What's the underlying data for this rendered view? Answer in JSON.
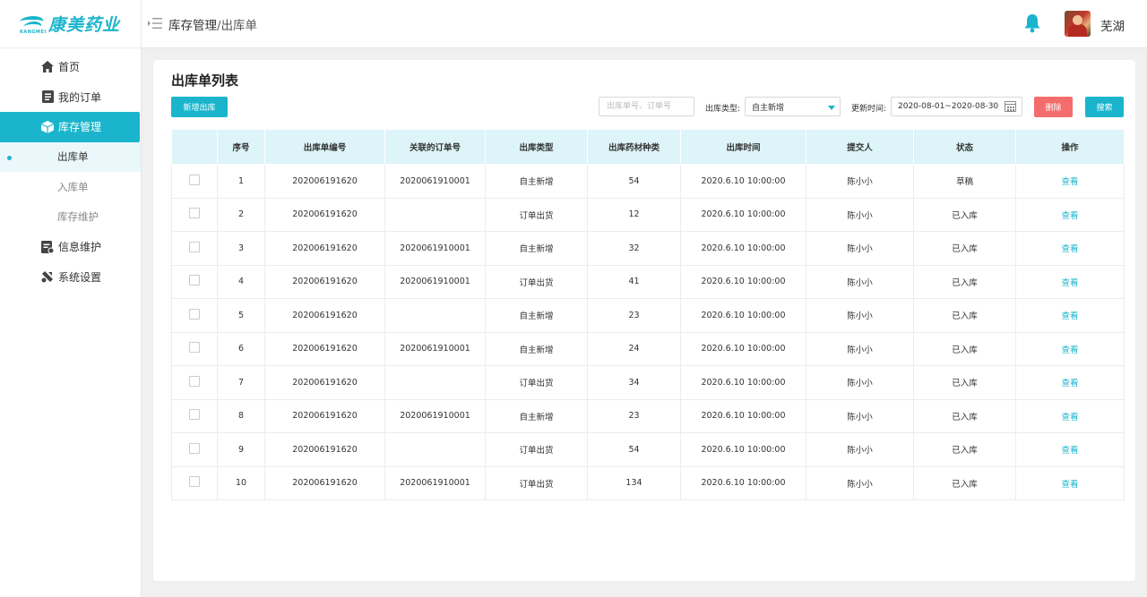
{
  "brand": {
    "name": "康美药业",
    "subtitle": "KANGMEI",
    "color": "#1ab5cc"
  },
  "sidebar": {
    "items": [
      {
        "label": "首页",
        "icon": "home-icon"
      },
      {
        "label": "我的订单",
        "icon": "order-icon"
      },
      {
        "label": "库存管理",
        "icon": "box-icon",
        "active": true
      },
      {
        "label": "出库单",
        "sub": true,
        "current": true
      },
      {
        "label": "入库单",
        "sub": true
      },
      {
        "label": "库存维护",
        "sub": true
      },
      {
        "label": "信息维护",
        "icon": "info-icon"
      },
      {
        "label": "系统设置",
        "icon": "settings-icon"
      }
    ]
  },
  "header": {
    "breadcrumb_parent": "库存管理",
    "breadcrumb_sep": "/",
    "breadcrumb_current": "出库单",
    "username": "芜湖"
  },
  "main": {
    "title": "出库单列表",
    "new_button": "新增出库",
    "search_placeholder": "出库单号、订单号",
    "type_label": "出库类型:",
    "type_value": "自主新增",
    "time_label": "更新时间:",
    "time_value": "2020-08-01~2020-08-30",
    "delete_button": "删除",
    "search_button": "搜索"
  },
  "table": {
    "columns": [
      "序号",
      "出库单编号",
      "关联的订单号",
      "出库类型",
      "出库药材种类",
      "出库时间",
      "提交人",
      "状态",
      "操作"
    ],
    "rows": [
      {
        "no": "1",
        "code": "2020061916 20",
        "order": "20200619 10001",
        "type": "自主新增",
        "kinds": "54",
        "time": "2020.6.10  10:00:00",
        "user": "陈小小",
        "status": "草稿",
        "action": "查看"
      },
      {
        "no": "2",
        "code": "2020061916 20",
        "order": "",
        "type": "订单出货",
        "kinds": "12",
        "time": "2020.6.10  10:00:00",
        "user": "陈小小",
        "status": "已入库",
        "action": "查看"
      },
      {
        "no": "3",
        "code": "2020061916 20",
        "order": "20200619 10001",
        "type": "自主新增",
        "kinds": "32",
        "time": "2020.6.10  10:00:00",
        "user": "陈小小",
        "status": "已入库",
        "action": "查看"
      },
      {
        "no": "4",
        "code": "2020061916 20",
        "order": "20200619 10001",
        "type": "订单出货",
        "kinds": "41",
        "time": "2020.6.10  10:00:00",
        "user": "陈小小",
        "status": "已入库",
        "action": "查看"
      },
      {
        "no": "5",
        "code": "2020061916 20",
        "order": "",
        "type": "自主新增",
        "kinds": "23",
        "time": "2020.6.10  10:00:00",
        "user": "陈小小",
        "status": "已入库",
        "action": "查看"
      },
      {
        "no": "6",
        "code": "2020061916 20",
        "order": "20200619 10001",
        "type": "自主新增",
        "kinds": "24",
        "time": "2020.6.10  10:00:00",
        "user": "陈小小",
        "status": "已入库",
        "action": "查看"
      },
      {
        "no": "7",
        "code": "2020061916 20",
        "order": "",
        "type": "订单出货",
        "kinds": "34",
        "time": "2020.6.10  10:00:00",
        "user": "陈小小",
        "status": "已入库",
        "action": "查看"
      },
      {
        "no": "8",
        "code": "2020061916 20",
        "order": "20200619 10001",
        "type": "自主新增",
        "kinds": "23",
        "time": "2020.6.10  10:00:00",
        "user": "陈小小",
        "status": "已入库",
        "action": "查看"
      },
      {
        "no": "9",
        "code": "2020061916 20",
        "order": "",
        "type": "订单出货",
        "kinds": "54",
        "time": "2020.6.10  10:00:00",
        "user": "陈小小",
        "status": "已入库",
        "action": "查看"
      },
      {
        "no": "10",
        "code": "2020061916 20",
        "order": "20200619 10001",
        "type": "订单出货",
        "kinds": "134",
        "time": "2020.6.10  10:00:00",
        "user": "陈小小",
        "status": "已入库",
        "action": "查看"
      }
    ]
  },
  "colors": {
    "accent": "#1ab5cc",
    "danger": "#f56c6c",
    "header_row": "#ddf4f8"
  }
}
